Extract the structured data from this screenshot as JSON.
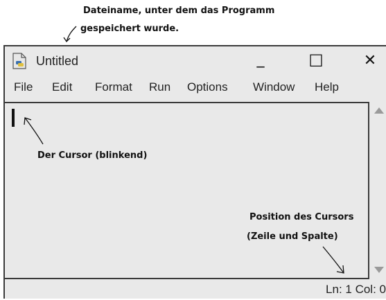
{
  "annotations": {
    "filename_line1": "Dateiname, unter dem das Programm",
    "filename_line2": "gespeichert wurde.",
    "cursor_label": "Der Cursor (blinkend)",
    "position_line1": "Position des Cursors",
    "position_line2": "(Zeile und Spalte)"
  },
  "window": {
    "title": "Untitled",
    "minimize_symbol": "_",
    "maximize_symbol": "☐",
    "close_symbol": "✕"
  },
  "menu": {
    "items": [
      "File",
      "Edit",
      "Format",
      "Run",
      "Options",
      "Window",
      "Help"
    ]
  },
  "status": {
    "position": "Ln: 1 Col: 0"
  },
  "icons": {
    "app": "python-file-icon",
    "scroll_up": "scroll-up-arrow-icon",
    "scroll_down": "scroll-down-arrow-icon"
  },
  "colors": {
    "window_bg": "#e9e9e9",
    "border": "#3a3a3a",
    "scroll_arrow": "#9a9a9a"
  }
}
